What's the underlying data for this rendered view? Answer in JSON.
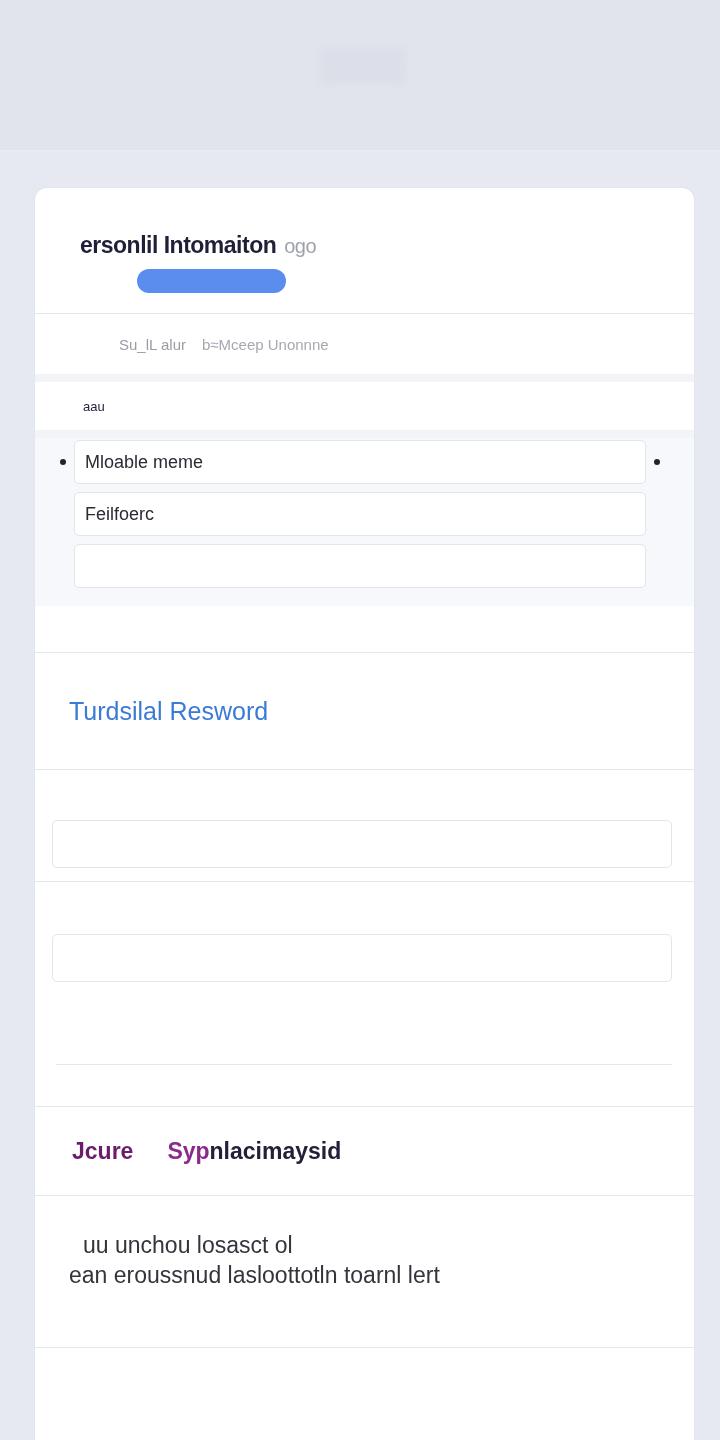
{
  "header": {
    "title": "ersonlil Intomaiton",
    "faded_suffix": "ogo"
  },
  "tabs_row": {
    "left": "Su_lL alur",
    "right": "b≈Mceep Unonnne"
  },
  "name_section": {
    "label": "aau",
    "fields": [
      {
        "value": "Mloable meme",
        "bulleted": true
      },
      {
        "value": "Feilfoerc",
        "bulleted": false
      },
      {
        "bulleted": false
      }
    ]
  },
  "password_section": {
    "title": "Turdsilal Resword"
  },
  "secure_row": {
    "label": "Jcure",
    "text": "**Syp**nlacimaysid"
  },
  "note": {
    "lines": [
      "uu unchou  losasct  ol",
      "ean eroussnud  lasloottotln  toarnl  lert"
    ]
  }
}
